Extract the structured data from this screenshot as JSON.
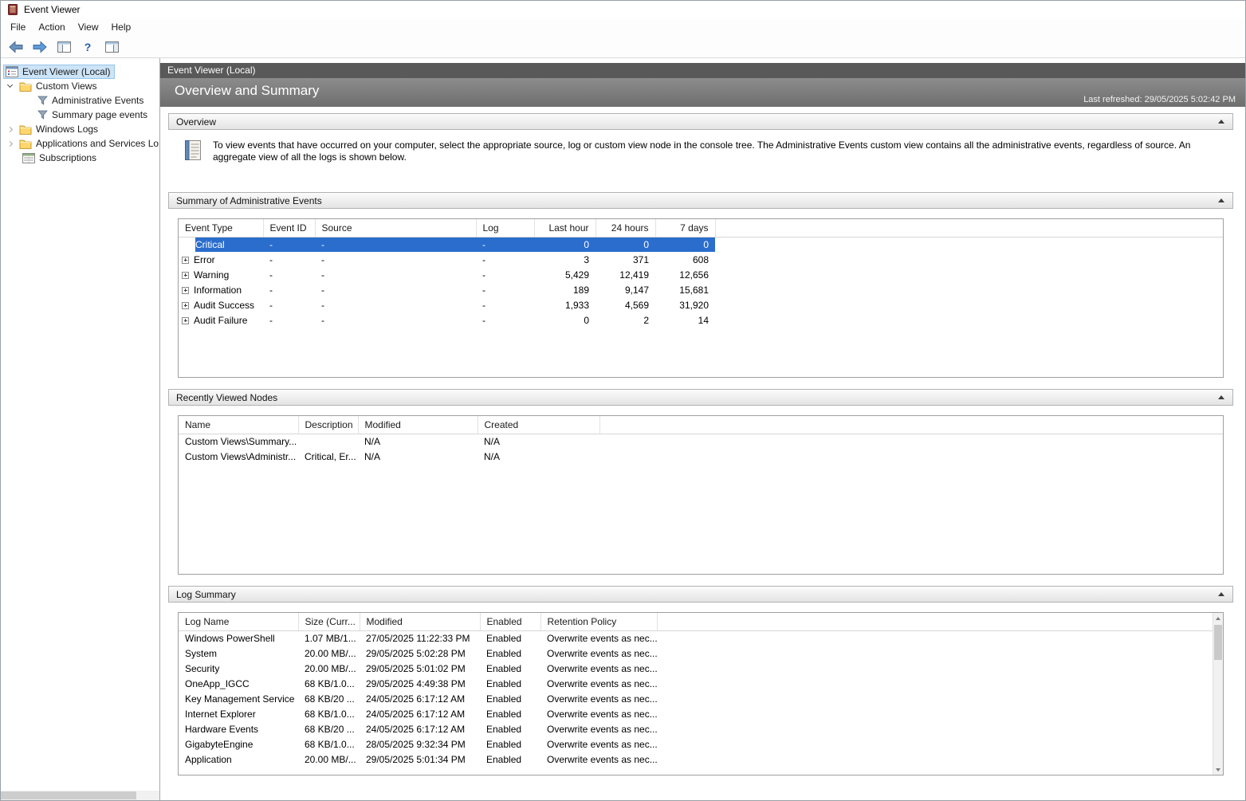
{
  "window": {
    "title": "Event Viewer"
  },
  "menubar": {
    "items": [
      "File",
      "Action",
      "View",
      "Help"
    ]
  },
  "icons": {
    "help": "?"
  },
  "colors": {
    "selection_blue": "#2a6dcd",
    "header_dark": "#595959",
    "banner_gray": "#7d7d7d"
  },
  "tree": {
    "root": "Event Viewer (Local)",
    "custom_views": "Custom Views",
    "administrative_events": "Administrative Events",
    "summary_page_events": "Summary page events",
    "windows_logs": "Windows Logs",
    "apps_services": "Applications and Services Lo",
    "subscriptions": "Subscriptions"
  },
  "main": {
    "pane_header": "Event Viewer (Local)",
    "page_title": "Overview and Summary",
    "last_refreshed": "Last refreshed: 29/05/2025 5:02:42 PM"
  },
  "overview": {
    "header": "Overview",
    "body": "To view events that have occurred on your computer, select the appropriate source, log or custom view node in the console tree. The Administrative Events custom view contains all the administrative events, regardless of source. An aggregate view of all the logs is shown below."
  },
  "summary": {
    "header": "Summary of Administrative Events",
    "columns": [
      "Event Type",
      "Event ID",
      "Source",
      "Log",
      "Last hour",
      "24 hours",
      "7 days"
    ],
    "rows": [
      {
        "selected": true,
        "expand": false,
        "cells": [
          "Critical",
          "-",
          "-",
          "-",
          "0",
          "0",
          "0"
        ]
      },
      {
        "selected": false,
        "expand": true,
        "cells": [
          "Error",
          "-",
          "-",
          "-",
          "3",
          "371",
          "608"
        ]
      },
      {
        "selected": false,
        "expand": true,
        "cells": [
          "Warning",
          "-",
          "-",
          "-",
          "5,429",
          "12,419",
          "12,656"
        ]
      },
      {
        "selected": false,
        "expand": true,
        "cells": [
          "Information",
          "-",
          "-",
          "-",
          "189",
          "9,147",
          "15,681"
        ]
      },
      {
        "selected": false,
        "expand": true,
        "cells": [
          "Audit Success",
          "-",
          "-",
          "-",
          "1,933",
          "4,569",
          "31,920"
        ]
      },
      {
        "selected": false,
        "expand": true,
        "cells": [
          "Audit Failure",
          "-",
          "-",
          "-",
          "0",
          "2",
          "14"
        ]
      }
    ]
  },
  "recent": {
    "header": "Recently Viewed Nodes",
    "columns": [
      "Name",
      "Description",
      "Modified",
      "Created"
    ],
    "rows": [
      {
        "cells": [
          "Custom Views\\Summary...",
          "",
          "N/A",
          "N/A"
        ]
      },
      {
        "cells": [
          "Custom Views\\Administr...",
          "Critical, Er...",
          "N/A",
          "N/A"
        ]
      }
    ]
  },
  "logs": {
    "header": "Log Summary",
    "columns": [
      "Log Name",
      "Size (Curr...",
      "Modified",
      "Enabled",
      "Retention Policy"
    ],
    "rows": [
      {
        "cells": [
          "Windows PowerShell",
          "1.07 MB/1...",
          "27/05/2025 11:22:33 PM",
          "Enabled",
          "Overwrite events as nec..."
        ]
      },
      {
        "cells": [
          "System",
          "20.00 MB/...",
          "29/05/2025 5:02:28 PM",
          "Enabled",
          "Overwrite events as nec..."
        ]
      },
      {
        "cells": [
          "Security",
          "20.00 MB/...",
          "29/05/2025 5:01:02 PM",
          "Enabled",
          "Overwrite events as nec..."
        ]
      },
      {
        "cells": [
          "OneApp_IGCC",
          "68 KB/1.0...",
          "29/05/2025 4:49:38 PM",
          "Enabled",
          "Overwrite events as nec..."
        ]
      },
      {
        "cells": [
          "Key Management Service",
          "68 KB/20 ...",
          "24/05/2025 6:17:12 AM",
          "Enabled",
          "Overwrite events as nec..."
        ]
      },
      {
        "cells": [
          "Internet Explorer",
          "68 KB/1.0...",
          "24/05/2025 6:17:12 AM",
          "Enabled",
          "Overwrite events as nec..."
        ]
      },
      {
        "cells": [
          "Hardware Events",
          "68 KB/20 ...",
          "24/05/2025 6:17:12 AM",
          "Enabled",
          "Overwrite events as nec..."
        ]
      },
      {
        "cells": [
          "GigabyteEngine",
          "68 KB/1.0...",
          "28/05/2025 9:32:34 PM",
          "Enabled",
          "Overwrite events as nec..."
        ]
      },
      {
        "cells": [
          "Application",
          "20.00 MB/...",
          "29/05/2025 5:01:34 PM",
          "Enabled",
          "Overwrite events as nec..."
        ]
      }
    ]
  }
}
